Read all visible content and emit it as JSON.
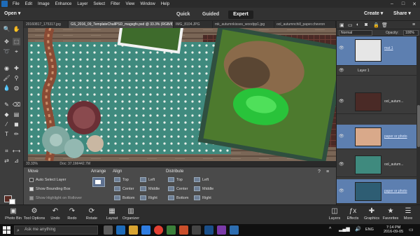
{
  "menubar": {
    "items": [
      "File",
      "Edit",
      "Image",
      "Enhance",
      "Layer",
      "Select",
      "Filter",
      "View",
      "Window",
      "Help"
    ]
  },
  "modebar": {
    "open_label": "Open",
    "modes": [
      "Quick",
      "Guided",
      "Expert"
    ],
    "active_mode": "Expert",
    "create_label": "Create",
    "share_label": "Share"
  },
  "tabs": [
    "20160817_175317.jpg",
    "GS_2016_09_TemplateChallPSD_magsgfx.psd @ 33.3% (RGB/8) *",
    "IMG_8104.JPG",
    "mk_autumnkisses_woodpp1.jpg",
    "ool_autumnchill_paper.chevron"
  ],
  "status": {
    "zoom": "33.33%",
    "doc": "Doc: 37.1M/442.7M"
  },
  "layers_panel": {
    "blend_mode": "Normal",
    "opacity_label": "Opacity:",
    "opacity_value": "100%",
    "group_name": "Layer 1",
    "layers": [
      {
        "name": "mat 1",
        "selected": true
      },
      {
        "name": "ool_autum...",
        "selected": false
      },
      {
        "name": "paper or photo",
        "selected": true
      },
      {
        "name": "ool_autum...",
        "selected": false
      },
      {
        "name": "paper or photo",
        "selected": true
      }
    ]
  },
  "tool_options": {
    "move_label": "Move",
    "auto_select": "Auto Select Layer",
    "show_bbox": "Show Bounding Box",
    "show_highlight": "Show Highlight on Rollover",
    "arrange_label": "Arrange",
    "align_label": "Align",
    "align_items": [
      "Top",
      "Center",
      "Bottom",
      "Left",
      "Middle",
      "Right"
    ],
    "distribute_label": "Distribute",
    "distribute_items": [
      "Top",
      "Center",
      "Bottom",
      "Left",
      "Middle",
      "Right"
    ]
  },
  "bottombar": {
    "left": [
      "Photo Bin",
      "Tool Options",
      "Undo",
      "Redo",
      "Rotate",
      "Layout",
      "Organizer"
    ],
    "right": [
      "Layers",
      "Effects",
      "Graphics",
      "Favorites",
      "More"
    ]
  },
  "taskbar": {
    "search_placeholder": "Ask me anything",
    "lang": "ENG",
    "time": "7:14 PM",
    "date": "2016-09-05"
  },
  "colors": {
    "accent": "#1e6bb8",
    "selected_layer": "#5d7fb0",
    "teal_paper": "#3f8a7e",
    "foreground_swatch": "#5a2a22"
  }
}
